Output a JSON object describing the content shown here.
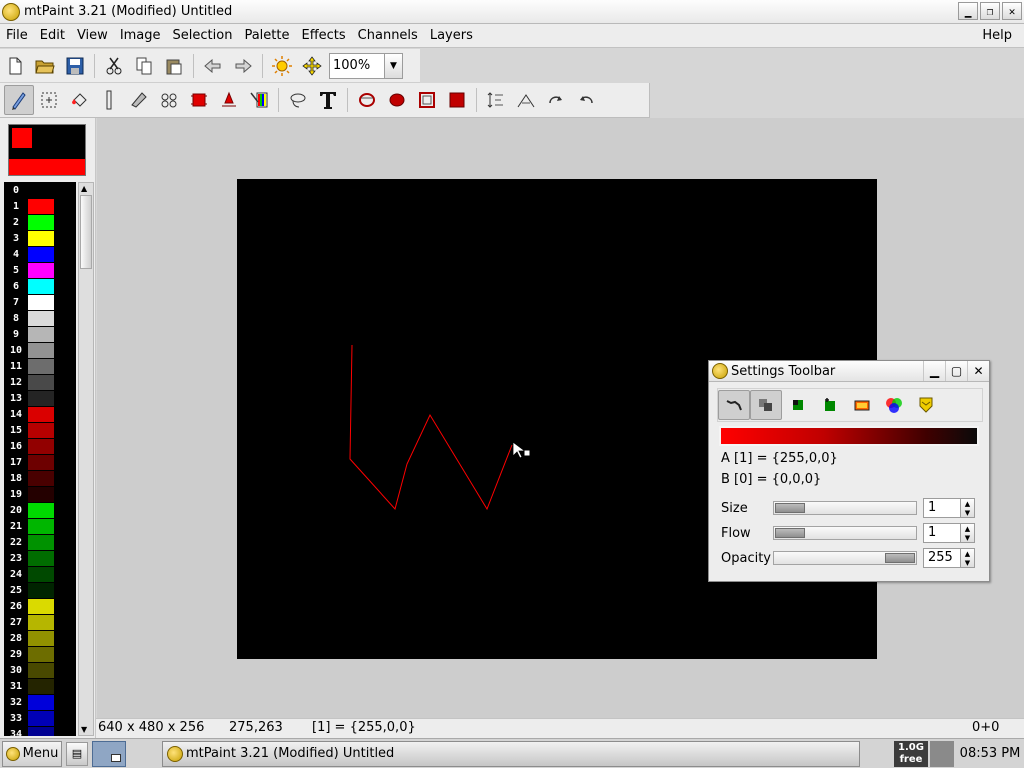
{
  "window": {
    "title": "mtPaint 3.21 (Modified) Untitled",
    "controls": {
      "minimize": "▁",
      "restore": "❐",
      "close": "✕"
    }
  },
  "menubar": {
    "items": [
      "File",
      "Edit",
      "View",
      "Image",
      "Selection",
      "Palette",
      "Effects",
      "Channels",
      "Layers"
    ],
    "help": "Help"
  },
  "toolbar_main": {
    "zoom_value": "100%",
    "icons": [
      "new-icon",
      "open-icon",
      "save-icon",
      "cut-icon",
      "copy-icon",
      "paste-icon",
      "undo-icon",
      "redo-icon",
      "transform-color-icon",
      "pan-icon"
    ]
  },
  "toolbar_tools": {
    "icons": [
      "paint-icon",
      "shuffle-icon",
      "flood-fill-icon",
      "straight-line-icon",
      "smudge-icon",
      "clone-icon",
      "select-rectangle-icon",
      "lasso-icon",
      "text-icon",
      "ellipse-outline-icon",
      "ellipse-fill-icon",
      "rectangle-outline-icon",
      "rectangle-fill-icon",
      "flip-vertical-icon",
      "flip-horizontal-icon",
      "rotate-clockwise-icon",
      "rotate-anticlockwise-icon"
    ]
  },
  "palette": {
    "entries": [
      {
        "index": "0",
        "color": "#000000"
      },
      {
        "index": "1",
        "color": "#ff0000"
      },
      {
        "index": "2",
        "color": "#00ff00"
      },
      {
        "index": "3",
        "color": "#ffff00"
      },
      {
        "index": "4",
        "color": "#0000ff"
      },
      {
        "index": "5",
        "color": "#ff00ff"
      },
      {
        "index": "6",
        "color": "#00ffff"
      },
      {
        "index": "7",
        "color": "#ffffff"
      },
      {
        "index": "8",
        "color": "#dadada"
      },
      {
        "index": "9",
        "color": "#b6b6b6"
      },
      {
        "index": "10",
        "color": "#929292"
      },
      {
        "index": "11",
        "color": "#6d6d6d"
      },
      {
        "index": "12",
        "color": "#494949"
      },
      {
        "index": "13",
        "color": "#242424"
      },
      {
        "index": "14",
        "color": "#da0000"
      },
      {
        "index": "15",
        "color": "#b60000"
      },
      {
        "index": "16",
        "color": "#920000"
      },
      {
        "index": "17",
        "color": "#6d0000"
      },
      {
        "index": "18",
        "color": "#490000"
      },
      {
        "index": "19",
        "color": "#240000"
      },
      {
        "index": "20",
        "color": "#00da00"
      },
      {
        "index": "21",
        "color": "#00b600"
      },
      {
        "index": "22",
        "color": "#009200"
      },
      {
        "index": "23",
        "color": "#006d00"
      },
      {
        "index": "24",
        "color": "#004900"
      },
      {
        "index": "25",
        "color": "#002400"
      },
      {
        "index": "26",
        "color": "#dada00"
      },
      {
        "index": "27",
        "color": "#b6b600"
      },
      {
        "index": "28",
        "color": "#929200"
      },
      {
        "index": "29",
        "color": "#6d6d00"
      },
      {
        "index": "30",
        "color": "#494900"
      },
      {
        "index": "31",
        "color": "#242400"
      },
      {
        "index": "32",
        "color": "#0000da"
      },
      {
        "index": "33",
        "color": "#0000b6"
      },
      {
        "index": "34",
        "color": "#000092"
      }
    ]
  },
  "colors": {
    "color_a": "#ff0000",
    "color_b": "#000000",
    "canvas_background": "#000000",
    "stroke": "#ff0000"
  },
  "statusbar": {
    "geometry": "640 x 480 x 256",
    "cursor": "275,263",
    "pixel": "[1] = {255,0,0}",
    "offset": "0+0"
  },
  "settings_toolbar": {
    "title": "Settings Toolbar",
    "color_a_line": "A [1] = {255,0,0}",
    "color_b_line": "B [0] = {0,0,0}",
    "size_label": "Size",
    "size_value": "1",
    "flow_label": "Flow",
    "flow_value": "1",
    "opacity_label": "Opacity",
    "opacity_value": "255",
    "icons": [
      "continuous-mode-icon",
      "opacity-mode-icon",
      "tint-mode-icon",
      "tint-add-icon",
      "cspace-mode-icon",
      "rgb-channels-icon",
      "brush-pattern-icon"
    ]
  },
  "taskbar": {
    "menu_label": "Menu",
    "task_title": "mtPaint 3.21 (Modified) Untitled",
    "memory_line1": "1.0G",
    "memory_line2": "free",
    "clock": "08:53 PM"
  }
}
